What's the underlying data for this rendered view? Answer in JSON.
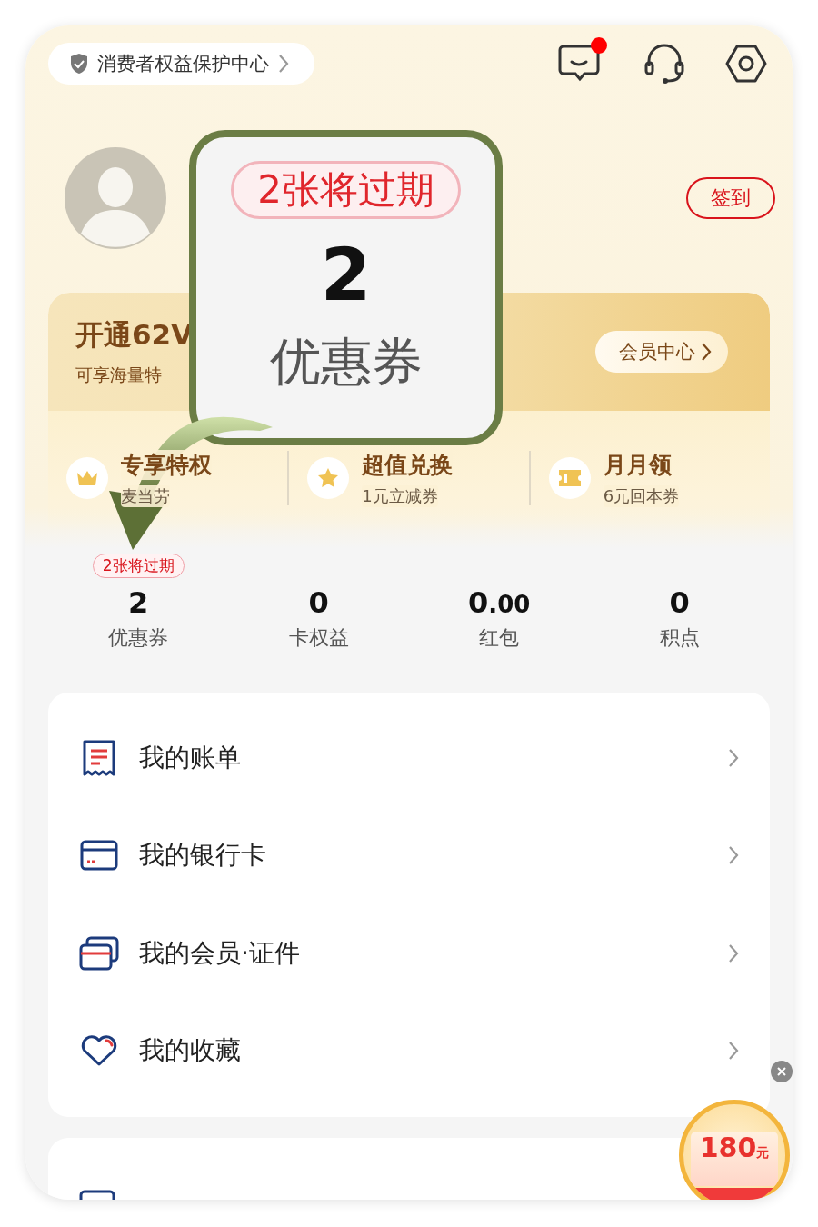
{
  "consumer_protection": {
    "label": "消费者权益保护中心"
  },
  "header_icons": [
    {
      "kind": "message",
      "unread": true
    },
    {
      "kind": "headset",
      "unread": false
    },
    {
      "kind": "settings",
      "unread": false
    }
  ],
  "profile": {
    "checkin_button": "签到"
  },
  "membership": {
    "title": "开通62V",
    "subtitle": "可享海量特",
    "button": "会员中心",
    "benefits": [
      {
        "kind": "crown",
        "title": "专享特权",
        "subtitle": "麦当劳"
      },
      {
        "kind": "star",
        "title": "超值兑换",
        "subtitle": "1元立减券"
      },
      {
        "kind": "ticket",
        "title": "月月领",
        "subtitle": "6元回本券"
      }
    ]
  },
  "stats": [
    {
      "value": "2",
      "label": "优惠券",
      "badge": "2张将过期"
    },
    {
      "value": "0",
      "label": "卡权益"
    },
    {
      "value": "0",
      "fraction": ".00",
      "label": "红包"
    },
    {
      "value": "0",
      "label": "积点"
    }
  ],
  "menu": [
    {
      "kind": "bill",
      "label": "我的账单"
    },
    {
      "kind": "card",
      "label": "我的银行卡"
    },
    {
      "kind": "cards",
      "label": "我的会员·证件"
    },
    {
      "kind": "heart",
      "label": "我的收藏"
    }
  ],
  "promo_badge": {
    "amount": "180",
    "unit": "元"
  },
  "callout": {
    "badge": "2张将过期",
    "value": "2",
    "label": "优惠券"
  }
}
